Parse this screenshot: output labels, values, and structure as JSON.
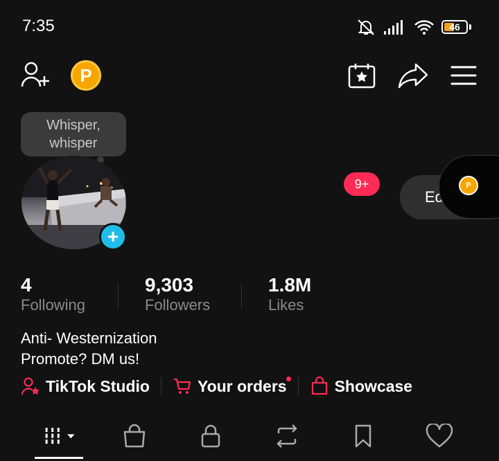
{
  "status_bar": {
    "time": "7:35",
    "battery": "46",
    "battery_level": 0.46
  },
  "header": {
    "coin_letter": "P"
  },
  "tooltip": {
    "line1": "Whisper,",
    "line2": "whisper"
  },
  "profile": {
    "notification_badge": "9+",
    "edit_label": "Edit"
  },
  "stats": [
    {
      "value": "4",
      "label": "Following"
    },
    {
      "value": "9,303",
      "label": "Followers"
    },
    {
      "value": "1.8M",
      "label": "Likes"
    }
  ],
  "bio": {
    "line1": "Anti- Westernization",
    "line2": "Promote? DM us!"
  },
  "links": {
    "studio": "TikTok Studio",
    "orders": "Your orders",
    "showcase": "Showcase"
  },
  "colors": {
    "accent": "#fe2c55",
    "coin": "#f7a600",
    "add_button": "#20bde8",
    "background": "#121212"
  },
  "icons": {
    "tabs": [
      "videos-grid-icon",
      "shop-bag-icon",
      "lock-icon",
      "repost-icon",
      "bookmark-icon",
      "heart-icon"
    ]
  }
}
